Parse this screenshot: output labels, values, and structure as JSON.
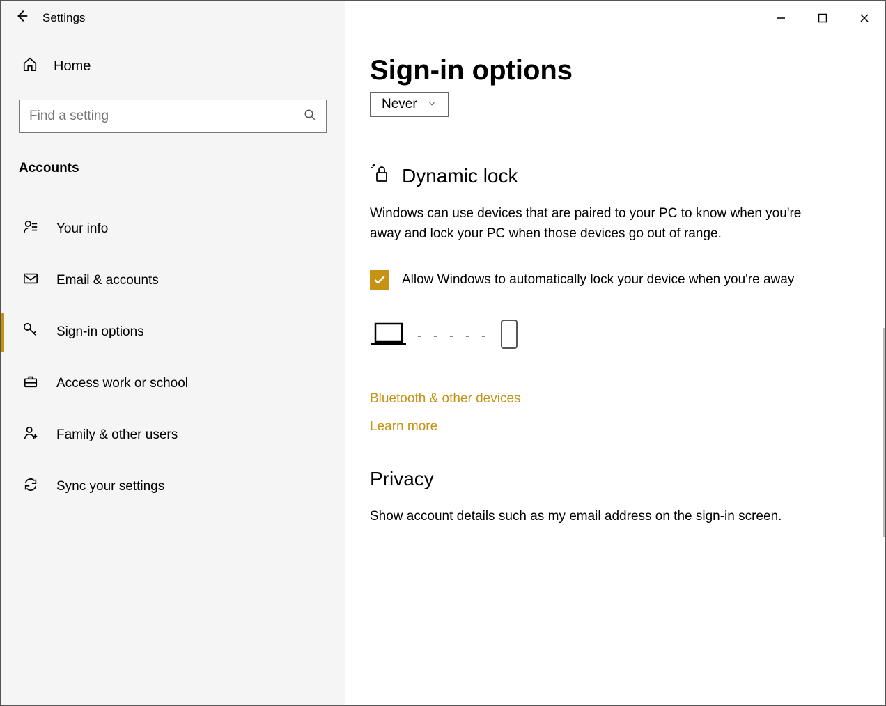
{
  "titlebar": {
    "title": "Settings"
  },
  "sidebar": {
    "home": "Home",
    "search_placeholder": "Find a setting",
    "section": "Accounts",
    "items": [
      {
        "icon": "person",
        "label": "Your info"
      },
      {
        "icon": "mail",
        "label": "Email & accounts"
      },
      {
        "icon": "key",
        "label": "Sign-in options",
        "active": true
      },
      {
        "icon": "brief",
        "label": "Access work or school"
      },
      {
        "icon": "family",
        "label": "Family & other users"
      },
      {
        "icon": "sync",
        "label": "Sync your settings"
      }
    ]
  },
  "page": {
    "title": "Sign-in options",
    "require_signin_value": "Never",
    "dynamic_lock": {
      "heading": "Dynamic lock",
      "description": "Windows can use devices that are paired to your PC to know when you're away and lock your PC when those devices go out of range.",
      "checkbox_label": "Allow Windows to automatically lock your device when you're away",
      "checked": true,
      "link_bluetooth": "Bluetooth & other devices",
      "link_learn": "Learn more"
    },
    "privacy": {
      "heading": "Privacy",
      "description": "Show account details such as my email address on the sign-in screen."
    }
  }
}
